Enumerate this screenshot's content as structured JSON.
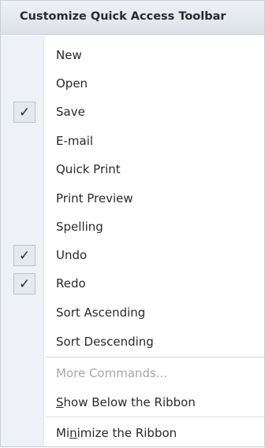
{
  "menu": {
    "title": "Customize Quick Access Toolbar",
    "items": [
      {
        "label": "New",
        "checked": false
      },
      {
        "label": "Open",
        "checked": false
      },
      {
        "label": "Save",
        "checked": true
      },
      {
        "label": "E-mail",
        "checked": false
      },
      {
        "label": "Quick Print",
        "checked": false
      },
      {
        "label": "Print Preview",
        "checked": false
      },
      {
        "label": "Spelling",
        "checked": false
      },
      {
        "label": "Undo",
        "checked": true
      },
      {
        "label": "Redo",
        "checked": true
      },
      {
        "label": "Sort Ascending",
        "checked": false
      },
      {
        "label": "Sort Descending",
        "checked": false
      }
    ],
    "more_commands": {
      "label": "More Commands...",
      "disabled": true
    },
    "show_below": {
      "pre": "",
      "accel": "S",
      "post": "how Below the Ribbon"
    },
    "minimize": {
      "pre": "Mi",
      "accel": "n",
      "post": "imize the Ribbon"
    },
    "check_glyph": "✓"
  }
}
